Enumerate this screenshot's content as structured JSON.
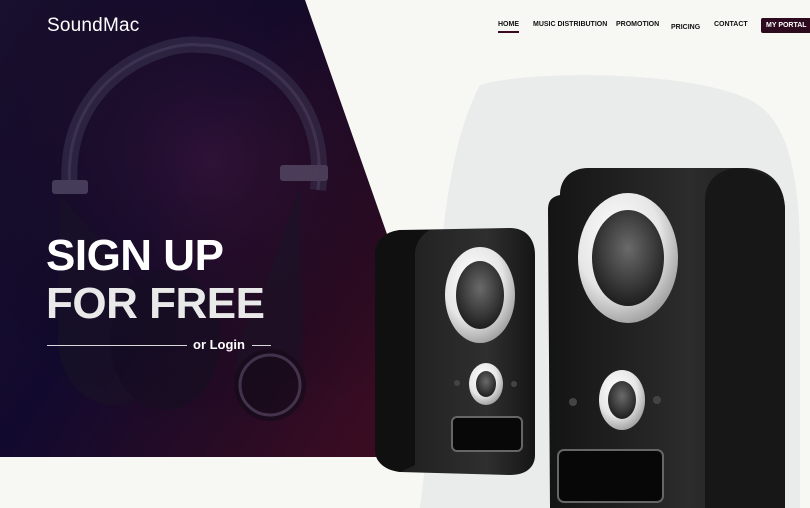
{
  "header": {
    "logo": "SoundMac",
    "nav": [
      {
        "label": "HOME",
        "active": true
      },
      {
        "label": "MUSIC DISTRIBUTION"
      },
      {
        "label": "PROMOTION"
      },
      {
        "label": "PRICING"
      },
      {
        "label": "CONTACT"
      }
    ],
    "portal_button": "MY PORTAL"
  },
  "hero": {
    "title_line1": "SIGN UP",
    "title_line2": "FOR FREE",
    "login_link": "or Login"
  },
  "colors": {
    "hero_dark": "#14082e",
    "accent": "#2d0a1e",
    "page_bg": "#f7f7f3"
  },
  "icons": [
    "headphones-image",
    "speakers-image"
  ]
}
